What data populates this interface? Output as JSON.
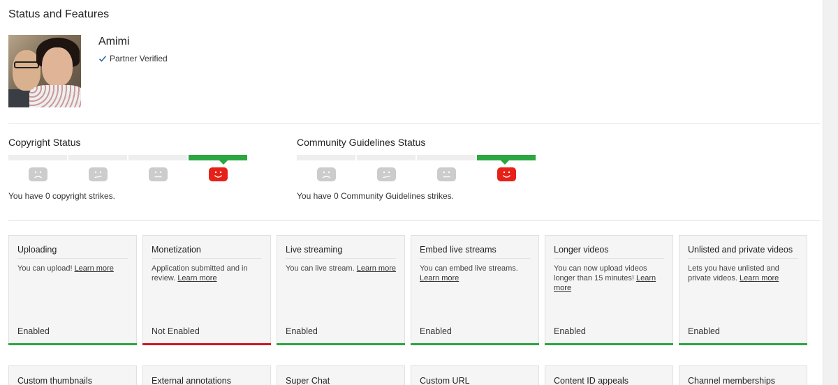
{
  "page": {
    "title": "Status and Features"
  },
  "channel": {
    "name": "Amimi",
    "verified_label": "Partner Verified"
  },
  "copyright": {
    "title": "Copyright Status",
    "strikes_text": "You have 0 copyright strikes.",
    "active_index": 3
  },
  "community": {
    "title": "Community Guidelines Status",
    "strikes_text": "You have 0 Community Guidelines strikes.",
    "active_index": 3
  },
  "colors": {
    "enabled": "#2ba640",
    "not_enabled": "#cc181e",
    "active_face": "#e62117"
  },
  "features": [
    {
      "title": "Uploading",
      "desc": "You can upload!",
      "link": "Learn more",
      "status": "Enabled"
    },
    {
      "title": "Monetization",
      "desc": "Application submitted and in review.",
      "link": "Learn more",
      "status": "Not Enabled"
    },
    {
      "title": "Live streaming",
      "desc": "You can live stream.",
      "link": "Learn more",
      "status": "Enabled"
    },
    {
      "title": "Embed live streams",
      "desc": "You can embed live streams.",
      "link": "Learn more",
      "status": "Enabled"
    },
    {
      "title": "Longer videos",
      "desc": "You can now upload videos longer than 15 minutes!",
      "link": "Learn more",
      "status": "Enabled"
    },
    {
      "title": "Unlisted and private videos",
      "desc": "Lets you have unlisted and private videos.",
      "link": "Learn more",
      "status": "Enabled"
    }
  ],
  "features_row2": [
    {
      "title": "Custom thumbnails"
    },
    {
      "title": "External annotations"
    },
    {
      "title": "Super Chat"
    },
    {
      "title": "Custom URL"
    },
    {
      "title": "Content ID appeals"
    },
    {
      "title": "Channel memberships"
    }
  ]
}
